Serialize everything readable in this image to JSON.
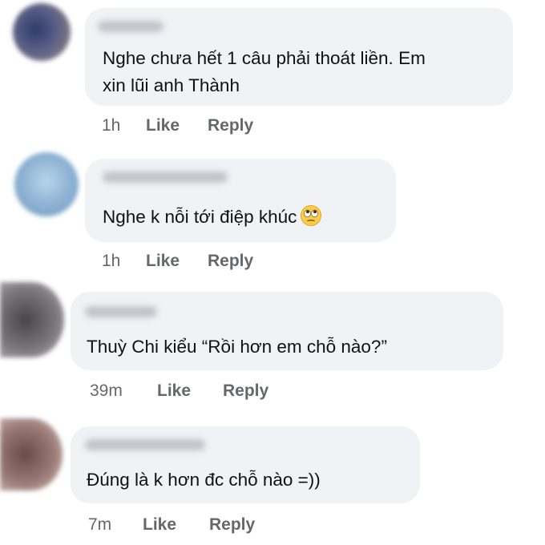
{
  "comments": [
    {
      "text_lines": [
        "Nghe chưa hết 1 câu phải thoát liền. Em",
        "xin lũi anh Thành"
      ],
      "time": "1h",
      "like": "Like",
      "reply": "Reply",
      "avatar_color": "#4a5a8a"
    },
    {
      "text_lines": [
        "Nghe k nỗi tới điệp khúc"
      ],
      "emoji": "rolling-eyes-emoji",
      "time": "1h",
      "like": "Like",
      "reply": "Reply",
      "avatar_color": "#8fb3d4"
    },
    {
      "text_lines": [
        "Thuỳ Chi kiểu “Rồi hơn em chỗ nào?”"
      ],
      "time": "39m",
      "like": "Like",
      "reply": "Reply",
      "avatar_color": "#6c6a6e"
    },
    {
      "text_lines": [
        "Đúng là k hơn đc chỗ nào =))"
      ],
      "time": "7m",
      "like": "Like",
      "reply": "Reply",
      "avatar_color": "#8a6a66"
    }
  ],
  "colors": {
    "bubble": "#f0f2f5",
    "secondary_text": "#65676b",
    "text": "#111111"
  }
}
